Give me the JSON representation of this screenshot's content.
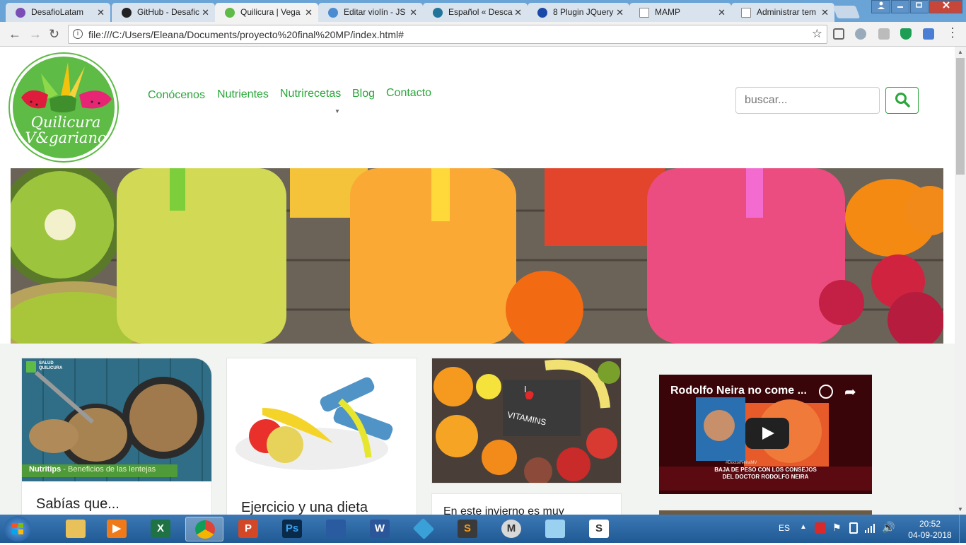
{
  "browser": {
    "tabs": [
      {
        "label": "DesafioLatam",
        "active": false
      },
      {
        "label": "GitHub - Desafic",
        "active": false
      },
      {
        "label": "Quilicura | Vega",
        "active": true
      },
      {
        "label": "Editar violín - JS",
        "active": false
      },
      {
        "label": "Español « Desca",
        "active": false
      },
      {
        "label": "8 Plugin JQuery",
        "active": false
      },
      {
        "label": "MAMP",
        "active": false
      },
      {
        "label": "Administrar tem",
        "active": false
      }
    ],
    "url": "file:///C:/Users/Eleana/Documents/proyecto%20final%20MP/index.html#",
    "close_glyph": "✕"
  },
  "site": {
    "logo_text_line1": "Quilicura",
    "logo_text_line2": "V&gariano",
    "nav": [
      {
        "label": "Conócenos"
      },
      {
        "label": "Nutrientes"
      },
      {
        "label": "Nutrirecetas"
      },
      {
        "label": "Blog"
      },
      {
        "label": "Contacto"
      }
    ],
    "search_placeholder": "buscar...",
    "accent_color": "#2aa63a",
    "cards": [
      {
        "title": "Sabías que...",
        "image_caption_bold": "Nutritips",
        "image_caption": " - Beneficios de las lentejas",
        "badge": "SALUD QUILICURA"
      },
      {
        "title": "Ejercicio y una dieta"
      },
      {
        "title": "En este invierno es muy",
        "image_text_1": "I",
        "image_text_2": "VITAMINS"
      }
    ],
    "video": {
      "title": "Rodolfo Neira no come ...",
      "banner_1": "BAJA DE PESO CON LOS CONSEJOS",
      "banner_2": "DEL DOCTOR RODOLFO NEIRA",
      "tag": "#DoctorNeiraMV"
    }
  },
  "taskbar": {
    "language": "ES",
    "time": "20:52",
    "date": "04-09-2018"
  }
}
